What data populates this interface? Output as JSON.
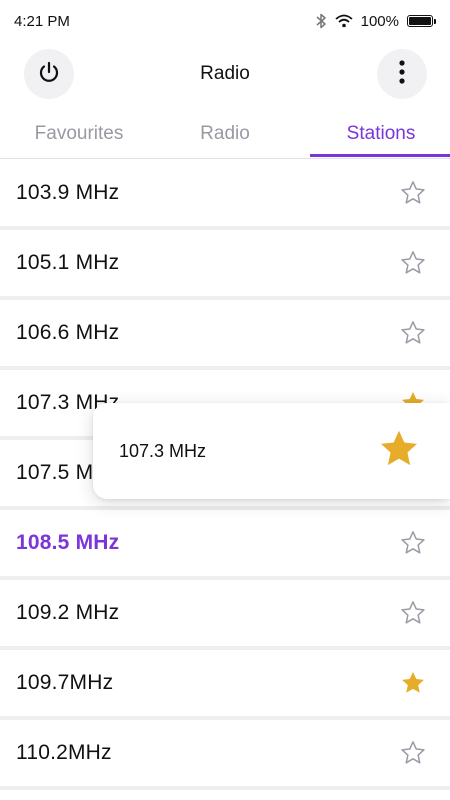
{
  "status": {
    "time": "4:21 PM",
    "battery": "100%"
  },
  "app": {
    "title": "Radio"
  },
  "tabs": [
    {
      "label": "Favourites",
      "active": false
    },
    {
      "label": "Radio",
      "active": false
    },
    {
      "label": "Stations",
      "active": true
    }
  ],
  "stations": [
    {
      "frequency": "103.9 MHz",
      "favourite": false,
      "playing": false
    },
    {
      "frequency": "105.1 MHz",
      "favourite": false,
      "playing": false
    },
    {
      "frequency": "106.6 MHz",
      "favourite": false,
      "playing": false
    },
    {
      "frequency": "107.3 MHz",
      "favourite": true,
      "playing": false
    },
    {
      "frequency": "107.5 MHz",
      "favourite": false,
      "playing": false
    },
    {
      "frequency": "108.5 MHz",
      "favourite": false,
      "playing": true
    },
    {
      "frequency": "109.2 MHz",
      "favourite": false,
      "playing": false
    },
    {
      "frequency": "109.7MHz",
      "favourite": true,
      "playing": false
    },
    {
      "frequency": "110.2MHz",
      "favourite": false,
      "playing": false
    }
  ],
  "popup": {
    "frequency": "107.3 MHz",
    "favourite": true
  },
  "colors": {
    "accent": "#7b35d8",
    "star_filled": "#e6ac2a",
    "star_outline": "#9c9aa6"
  },
  "icons": {
    "power": "power-icon",
    "menu": "more-vertical-icon",
    "bluetooth": "bluetooth-icon",
    "wifi": "wifi-icon",
    "battery": "battery-icon",
    "favourite": "star-icon"
  }
}
